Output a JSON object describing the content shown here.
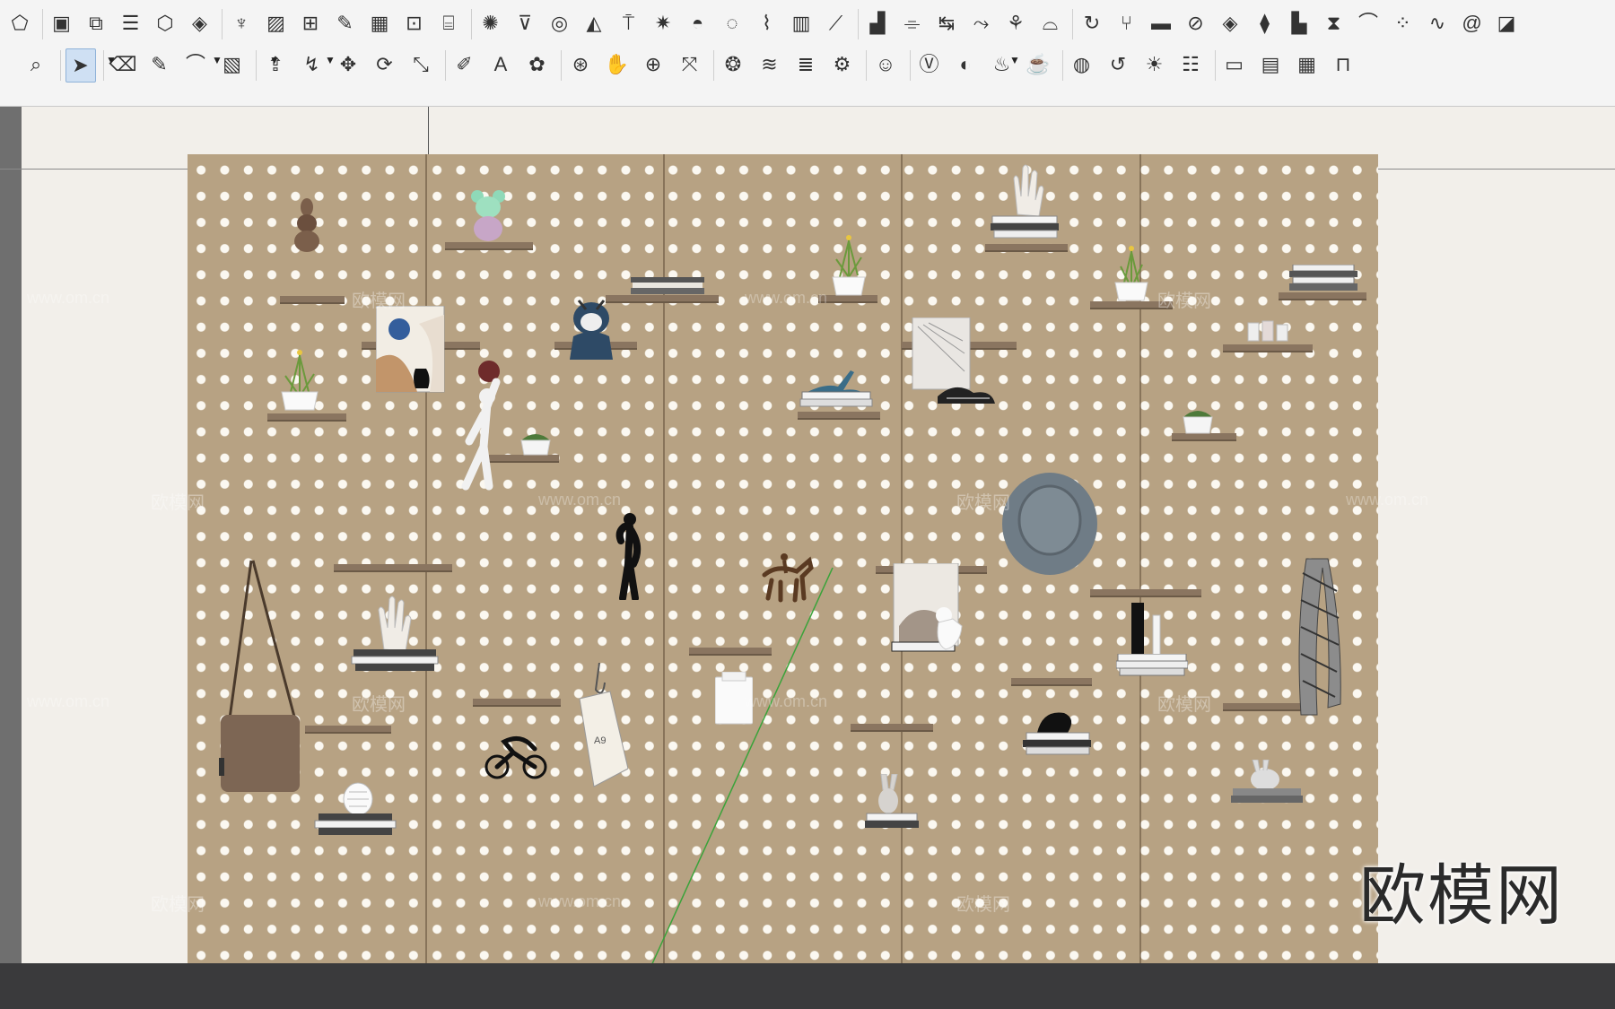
{
  "toolbar": {
    "row1_icons": [
      "shape-icon",
      "box-select-icon",
      "component-icon",
      "layer-icon",
      "component-box-icon",
      "component-cube-icon",
      "grass-icon",
      "texture-icon",
      "section-icon",
      "edit-icon",
      "grid-icon",
      "array-icon",
      "structure-icon",
      "render-icon",
      "shading-icon",
      "circle-icon",
      "triangle-icon",
      "stool-icon",
      "light-icon",
      "dome-icon",
      "sphere-icon",
      "stairs-icon",
      "column-icon",
      "ramp-icon",
      "bars-icon",
      "profile-icon",
      "measure-icon",
      "curve-icon",
      "tree-icon",
      "frame-icon",
      "loop-icon",
      "branch-icon",
      "panel-icon",
      "knot-icon",
      "layers-icon",
      "stack-icon",
      "bookend-icon",
      "scatter-icon",
      "arc-icon",
      "dots-icon",
      "wave-icon",
      "spiral-icon",
      "split-icon"
    ],
    "row2_icons": [
      "zoom-icon",
      "select-icon",
      "eraser-icon",
      "pencil-icon",
      "arc-tool-icon",
      "rectangle-icon",
      "push-pull-icon",
      "follow-me-icon",
      "move-icon",
      "rotate-icon",
      "scale-icon",
      "tape-icon",
      "text-icon",
      "paint-icon",
      "orbit-icon",
      "pan-icon",
      "zoom-window-icon",
      "zoom-extents-icon",
      "material-icon",
      "hatch-icon",
      "stack-layers-icon",
      "model-info-icon",
      "user-icon",
      "vray-icon",
      "vray-material-icon",
      "teapot-icon",
      "teapot-render-icon",
      "frame-buffer-icon",
      "refresh-icon",
      "light-gen-icon",
      "light-list-icon",
      "window-icon",
      "window-render-icon",
      "window-image-icon",
      "lock-icon"
    ]
  },
  "watermarks": [
    "欧模网",
    "www.om.cn"
  ],
  "brand_text": "欧模网",
  "colors": {
    "pegboard": "#b7a283",
    "holes": "#fbf8f1",
    "axis_green": "#3aa33a",
    "floor": "#3a3a3c"
  }
}
